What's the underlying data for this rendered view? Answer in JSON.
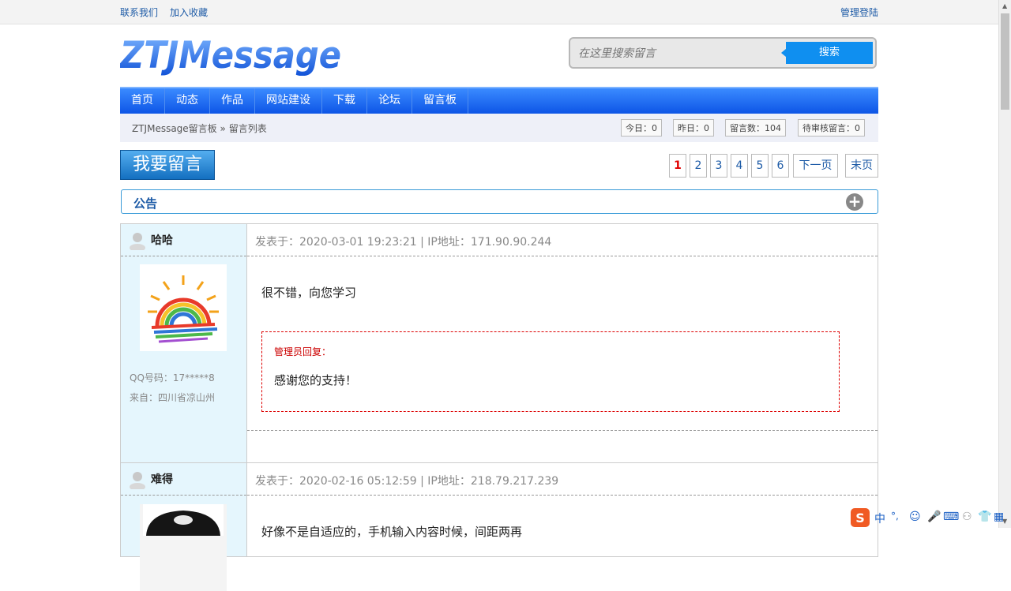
{
  "topbar": {
    "contact": "联系我们",
    "favorite": "加入收藏",
    "admin_login": "管理登陆"
  },
  "logo": {
    "text": "ZTJMessage"
  },
  "search": {
    "placeholder": "在这里搜索留言",
    "button": "搜索"
  },
  "nav": {
    "items": [
      "首页",
      "动态",
      "作品",
      "网站建设",
      "下载",
      "论坛",
      "留言板"
    ]
  },
  "breadcrumb": {
    "home": "ZTJMessage留言板",
    "sep": "»",
    "current": "留言列表"
  },
  "stats": {
    "today": "今日：0",
    "yesterday": "昨日：0",
    "total": "留言数：104",
    "pending": "待审核留言：0"
  },
  "post_button": "我要留言",
  "pagination": {
    "pages": [
      "1",
      "2",
      "3",
      "4",
      "5",
      "6"
    ],
    "current": "1",
    "next": "下一页",
    "last": "末页"
  },
  "notice": {
    "title": "公告"
  },
  "messages": [
    {
      "author": "哈哈",
      "meta": "发表于：2020-03-01 19:23:21 | IP地址：171.90.90.244",
      "qq": "QQ号码：17*****8",
      "from": "来自：四川省凉山州",
      "content": "很不错，向您学习",
      "reply_label": "管理员回复：",
      "reply": "感谢您的支持！"
    },
    {
      "author": "难得",
      "meta": "发表于：2020-02-16 05:12:59 | IP地址：218.79.217.239",
      "content": "好像不是自适应的，手机输入内容时候，间距两再"
    }
  ],
  "ime": {
    "lang": "中",
    "punct": "°,"
  },
  "colors": {
    "nav": "#1565ee",
    "link": "#1c5aa6",
    "sidebar": "#e5f6fd",
    "reply_border": "#dd0000"
  }
}
